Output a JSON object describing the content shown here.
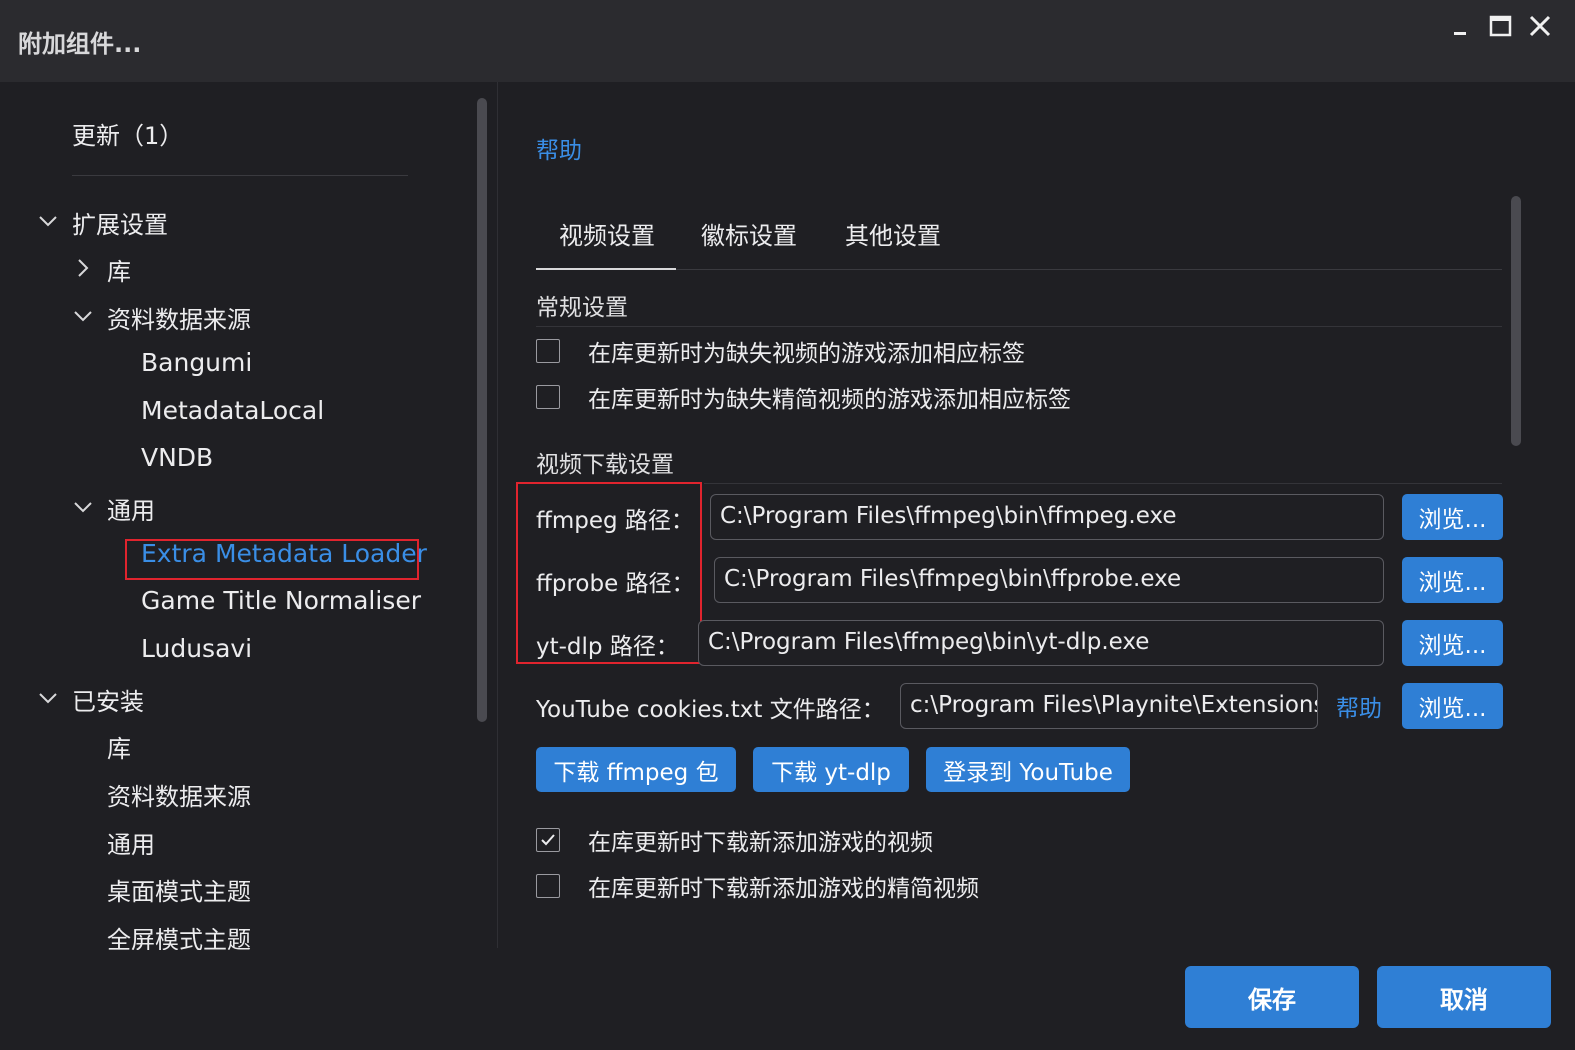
{
  "window": {
    "title": "附加组件..."
  },
  "sidebar": {
    "updates_label": "更新（1）",
    "ext_settings": "扩展设置",
    "library": "库",
    "metadata_sources": "资料数据来源",
    "metadata_items": [
      "Bangumi",
      "MetadataLocal",
      "VNDB"
    ],
    "generic": "通用",
    "generic_items": [
      "Extra Metadata Loader",
      "Game Title Normaliser",
      "Ludusavi"
    ],
    "installed": "已安装",
    "installed_items": [
      "库",
      "资料数据来源",
      "通用",
      "桌面模式主题",
      "全屏模式主题"
    ]
  },
  "content": {
    "help_link": "帮助",
    "tabs": [
      "视频设置",
      "徽标设置",
      "其他设置"
    ],
    "general_section": "常规设置",
    "general_options": [
      {
        "label": "在库更新时为缺失视频的游戏添加相应标签",
        "checked": false
      },
      {
        "label": "在库更新时为缺失精简视频的游戏添加相应标签",
        "checked": false
      }
    ],
    "download_section": "视频下载设置",
    "paths": [
      {
        "label": "ffmpeg 路径：",
        "value": "C:\\Program Files\\ffmpeg\\bin\\ffmpeg.exe",
        "browse": "浏览..."
      },
      {
        "label": "ffprobe 路径：",
        "value": "C:\\Program Files\\ffmpeg\\bin\\ffprobe.exe",
        "browse": "浏览..."
      },
      {
        "label": "yt-dlp 路径：",
        "value": "C:\\Program Files\\ffmpeg\\bin\\yt-dlp.exe",
        "browse": "浏览..."
      }
    ],
    "cookies": {
      "label": "YouTube cookies.txt 文件路径：",
      "value": "c:\\Program Files\\Playnite\\Extensions\\",
      "help": "帮助",
      "browse": "浏览..."
    },
    "action_buttons": [
      "下载 ffmpeg 包",
      "下载 yt-dlp",
      "登录到 YouTube"
    ],
    "download_options": [
      {
        "label": "在库更新时下载新添加游戏的视频",
        "checked": true
      },
      {
        "label": "在库更新时下载新添加游戏的精简视频",
        "checked": false
      }
    ]
  },
  "footer": {
    "save": "保存",
    "cancel": "取消"
  },
  "colors": {
    "accent": "#2f7fd5",
    "link": "#3a8ee6",
    "highlight_box": "#e0242e",
    "background": "#1f1f23",
    "titlebar": "#2b2b2f"
  }
}
